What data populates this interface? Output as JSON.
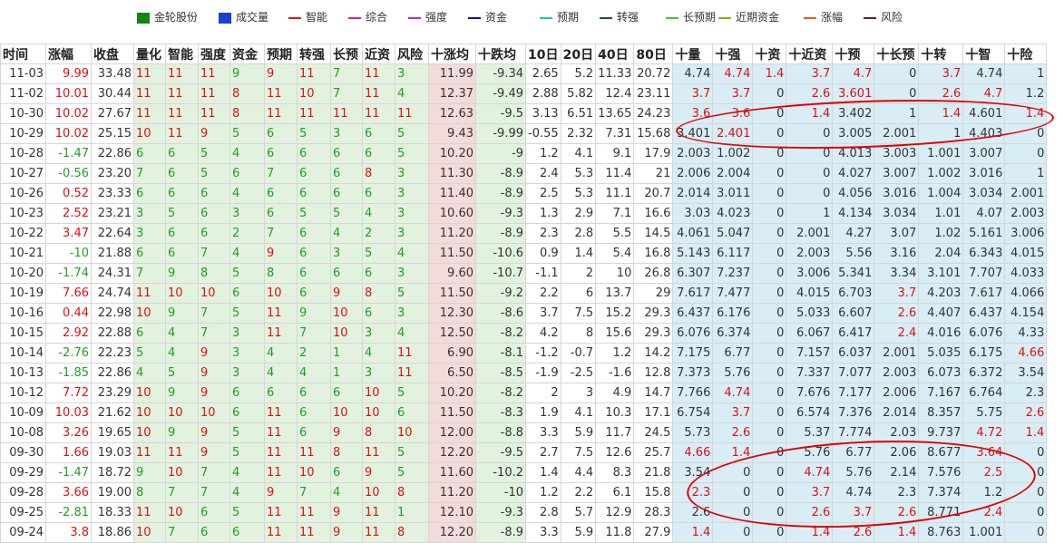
{
  "legend": [
    {
      "label": "金轮股份",
      "color": "#0f8a0f",
      "kind": "box"
    },
    {
      "label": "成交量",
      "color": "#1a3fd6",
      "kind": "box"
    },
    {
      "label": "智能",
      "color": "#e81010",
      "kind": "line"
    },
    {
      "label": "综合",
      "color": "#e01e8c",
      "kind": "line"
    },
    {
      "label": "强度",
      "color": "#c020c0",
      "kind": "line"
    },
    {
      "label": "资金",
      "color": "#10109a",
      "kind": "line"
    },
    {
      "label": "预期",
      "color": "#12c8c8",
      "kind": "line"
    },
    {
      "label": "转强",
      "color": "#1c5a1c",
      "kind": "line"
    },
    {
      "label": "长预期",
      "color": "#30d030",
      "kind": "line"
    },
    {
      "label": "近期资金",
      "color": "#a8a010",
      "kind": "line"
    },
    {
      "label": "涨幅",
      "color": "#f06010",
      "kind": "line"
    },
    {
      "label": "风险",
      "color": "#5a2020",
      "kind": "line"
    }
  ],
  "headers": [
    "时间",
    "涨幅",
    "收盘",
    "量化",
    "智能",
    "强度",
    "资金",
    "预期",
    "转强",
    "长预",
    "近资",
    "风险",
    "十涨均",
    "十跌均",
    "10日",
    "20日",
    "40日",
    "80日",
    "十量",
    "十强",
    "十资",
    "十近资",
    "十预",
    "十长预",
    "十转",
    "十智",
    "十险"
  ],
  "rows": [
    [
      "11-03",
      "9.99",
      "33.48",
      "11",
      "11",
      "11",
      "9",
      "9",
      "11",
      "7",
      "11",
      "3",
      "11.99",
      "-9.34",
      "2.65",
      "5.2",
      "11.33",
      "20.72",
      "4.74",
      "4.74",
      "1.4",
      "3.7",
      "4.7",
      "0",
      "3.7",
      "4.74",
      "1"
    ],
    [
      "11-02",
      "10.01",
      "30.44",
      "11",
      "11",
      "11",
      "8",
      "11",
      "10",
      "7",
      "11",
      "4",
      "12.37",
      "-9.49",
      "2.88",
      "5.82",
      "12.4",
      "23.11",
      "3.7",
      "3.7",
      "0",
      "2.6",
      "3.601",
      "0",
      "2.6",
      "4.7",
      "1.2"
    ],
    [
      "10-30",
      "10.02",
      "27.67",
      "11",
      "11",
      "11",
      "8",
      "11",
      "11",
      "11",
      "11",
      "11",
      "12.63",
      "-9.5",
      "3.13",
      "6.51",
      "13.65",
      "24.23",
      "3.6",
      "3.6",
      "0",
      "1.4",
      "3.402",
      "1",
      "1.4",
      "4.601",
      "1.4"
    ],
    [
      "10-29",
      "10.02",
      "25.15",
      "10",
      "11",
      "9",
      "5",
      "6",
      "5",
      "3",
      "6",
      "5",
      "9.43",
      "-9.99",
      "-0.55",
      "2.32",
      "7.31",
      "15.68",
      "3.401",
      "2.401",
      "0",
      "0",
      "3.005",
      "2.001",
      "1",
      "4.403",
      "0"
    ],
    [
      "10-28",
      "-1.47",
      "22.86",
      "6",
      "6",
      "5",
      "4",
      "6",
      "6",
      "6",
      "6",
      "5",
      "10.20",
      "-9",
      "1.2",
      "4.1",
      "9.1",
      "17.9",
      "2.003",
      "1.002",
      "0",
      "0",
      "4.013",
      "3.003",
      "1.001",
      "3.007",
      "0"
    ],
    [
      "10-27",
      "-0.56",
      "23.20",
      "7",
      "6",
      "5",
      "6",
      "7",
      "6",
      "6",
      "8",
      "3",
      "11.30",
      "-8.9",
      "2.4",
      "5.3",
      "11.4",
      "21",
      "2.006",
      "2.004",
      "0",
      "0",
      "4.027",
      "3.007",
      "1.002",
      "3.016",
      "1"
    ],
    [
      "10-26",
      "0.52",
      "23.33",
      "6",
      "6",
      "6",
      "4",
      "6",
      "6",
      "6",
      "6",
      "3",
      "11.40",
      "-8.9",
      "2.5",
      "5.3",
      "11.1",
      "20.7",
      "2.014",
      "3.011",
      "0",
      "0",
      "4.056",
      "3.016",
      "1.004",
      "3.034",
      "2.001"
    ],
    [
      "10-23",
      "2.52",
      "23.21",
      "3",
      "5",
      "6",
      "3",
      "6",
      "5",
      "5",
      "4",
      "3",
      "10.60",
      "-9.3",
      "1.3",
      "2.9",
      "7.1",
      "16.6",
      "3.03",
      "4.023",
      "0",
      "1",
      "4.134",
      "3.034",
      "1.01",
      "4.07",
      "2.003"
    ],
    [
      "10-22",
      "3.47",
      "22.64",
      "3",
      "6",
      "6",
      "2",
      "7",
      "6",
      "4",
      "2",
      "3",
      "11.20",
      "-8.9",
      "2.3",
      "2.8",
      "5.5",
      "14.5",
      "4.061",
      "5.047",
      "0",
      "2.001",
      "4.27",
      "3.07",
      "1.02",
      "5.161",
      "3.006"
    ],
    [
      "10-21",
      "-10",
      "21.88",
      "6",
      "6",
      "7",
      "4",
      "9",
      "6",
      "3",
      "5",
      "4",
      "11.50",
      "-10.6",
      "0.9",
      "1.4",
      "5.4",
      "16.8",
      "5.143",
      "6.117",
      "0",
      "2.003",
      "5.56",
      "3.16",
      "2.04",
      "6.343",
      "4.015"
    ],
    [
      "10-20",
      "-1.74",
      "24.31",
      "7",
      "9",
      "8",
      "5",
      "8",
      "6",
      "6",
      "6",
      "3",
      "9.60",
      "-10.7",
      "-1.1",
      "2",
      "10",
      "26.8",
      "6.307",
      "7.237",
      "0",
      "3.006",
      "5.341",
      "3.34",
      "3.101",
      "7.707",
      "4.033"
    ],
    [
      "10-19",
      "7.66",
      "24.74",
      "11",
      "10",
      "10",
      "6",
      "10",
      "6",
      "9",
      "8",
      "5",
      "11.50",
      "-9.2",
      "2.2",
      "6",
      "13.7",
      "29",
      "7.617",
      "7.477",
      "0",
      "4.015",
      "6.703",
      "3.7",
      "4.203",
      "7.617",
      "4.066"
    ],
    [
      "10-16",
      "0.44",
      "22.98",
      "10",
      "9",
      "7",
      "5",
      "11",
      "9",
      "10",
      "6",
      "3",
      "12.30",
      "-8.6",
      "3.7",
      "7.5",
      "15.2",
      "29.3",
      "6.437",
      "6.176",
      "0",
      "5.033",
      "6.607",
      "2.6",
      "4.407",
      "6.437",
      "4.154"
    ],
    [
      "10-15",
      "2.92",
      "22.88",
      "6",
      "4",
      "7",
      "3",
      "11",
      "7",
      "10",
      "3",
      "4",
      "12.50",
      "-8.2",
      "4.2",
      "8",
      "15.6",
      "29.3",
      "6.076",
      "6.374",
      "0",
      "6.067",
      "6.417",
      "2.4",
      "4.016",
      "6.076",
      "4.33"
    ],
    [
      "10-14",
      "-2.76",
      "22.23",
      "5",
      "4",
      "9",
      "3",
      "4",
      "2",
      "1",
      "4",
      "11",
      "6.90",
      "-8.1",
      "-1.2",
      "-0.7",
      "1.2",
      "14.2",
      "7.175",
      "6.77",
      "0",
      "7.157",
      "6.037",
      "2.001",
      "5.035",
      "6.175",
      "4.66"
    ],
    [
      "10-13",
      "-1.85",
      "22.86",
      "4",
      "5",
      "9",
      "3",
      "4",
      "4",
      "1",
      "3",
      "11",
      "6.50",
      "-8.5",
      "-1.9",
      "-2.5",
      "-1.6",
      "12.8",
      "7.373",
      "5.76",
      "0",
      "7.337",
      "7.077",
      "2.003",
      "6.073",
      "6.372",
      "3.54"
    ],
    [
      "10-12",
      "7.72",
      "23.29",
      "10",
      "9",
      "9",
      "6",
      "6",
      "6",
      "6",
      "10",
      "5",
      "10.20",
      "-8.2",
      "2",
      "3",
      "4.9",
      "14.7",
      "7.766",
      "4.74",
      "0",
      "7.676",
      "7.177",
      "2.006",
      "7.167",
      "6.764",
      "2.3"
    ],
    [
      "10-09",
      "10.03",
      "21.62",
      "10",
      "10",
      "10",
      "6",
      "11",
      "6",
      "10",
      "10",
      "6",
      "11.50",
      "-8.3",
      "1.9",
      "4.1",
      "10.3",
      "17.1",
      "6.754",
      "3.7",
      "0",
      "6.574",
      "7.376",
      "2.014",
      "8.357",
      "5.75",
      "2.6"
    ],
    [
      "10-08",
      "3.26",
      "19.65",
      "10",
      "9",
      "9",
      "5",
      "11",
      "6",
      "9",
      "8",
      "10",
      "12.00",
      "-8.8",
      "3.3",
      "5.9",
      "11.7",
      "24.5",
      "5.73",
      "2.6",
      "0",
      "5.37",
      "7.774",
      "2.03",
      "9.737",
      "4.72",
      "1.4"
    ],
    [
      "09-30",
      "1.66",
      "19.03",
      "11",
      "11",
      "9",
      "5",
      "11",
      "11",
      "8",
      "11",
      "5",
      "12.20",
      "-9.5",
      "2.7",
      "7.5",
      "12.6",
      "25.7",
      "4.66",
      "1.4",
      "0",
      "5.76",
      "6.77",
      "2.06",
      "8.677",
      "3.64",
      "0"
    ],
    [
      "09-29",
      "-1.47",
      "18.72",
      "9",
      "10",
      "7",
      "4",
      "11",
      "10",
      "6",
      "9",
      "5",
      "11.60",
      "-10.2",
      "1.4",
      "4.4",
      "8.3",
      "21.8",
      "3.54",
      "0",
      "0",
      "4.74",
      "5.76",
      "2.14",
      "7.576",
      "2.5",
      "0"
    ],
    [
      "09-28",
      "3.66",
      "19.00",
      "8",
      "7",
      "7",
      "4",
      "9",
      "7",
      "4",
      "10",
      "8",
      "11.20",
      "-10",
      "1.2",
      "2.2",
      "6.1",
      "15.8",
      "2.3",
      "0",
      "0",
      "3.7",
      "4.74",
      "2.3",
      "7.374",
      "1.2",
      "0"
    ],
    [
      "09-25",
      "-2.81",
      "18.33",
      "11",
      "10",
      "6",
      "5",
      "11",
      "11",
      "9",
      "11",
      "1",
      "12.10",
      "-9.3",
      "2.8",
      "5.7",
      "12.9",
      "28.3",
      "2.6",
      "0",
      "0",
      "2.6",
      "3.7",
      "2.6",
      "8.771",
      "2.4",
      "0"
    ],
    [
      "09-24",
      "3.8",
      "18.86",
      "10",
      "7",
      "6",
      "6",
      "11",
      "11",
      "9",
      "11",
      "8",
      "12.20",
      "-8.9",
      "3.3",
      "5.9",
      "11.8",
      "27.9",
      "1.4",
      "0",
      "0",
      "1.4",
      "2.6",
      "1.4",
      "8.763",
      "1.001",
      "0"
    ]
  ]
}
